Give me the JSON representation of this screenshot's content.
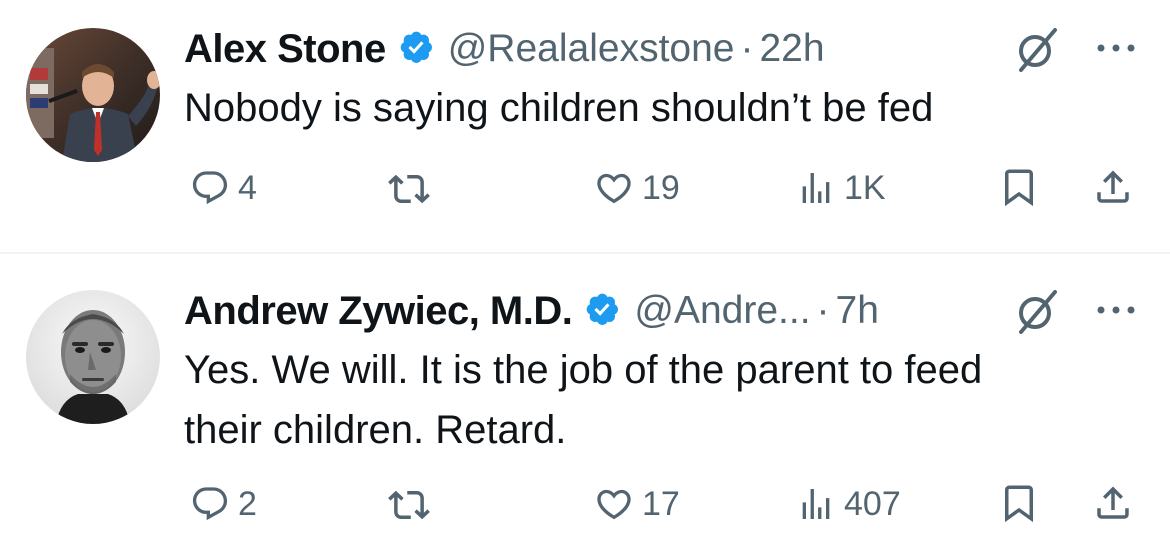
{
  "colors": {
    "verified": "#1d9bf0",
    "secondary_text": "#536471",
    "primary_text": "#0f1419",
    "divider": "#eff3f4"
  },
  "tweets": [
    {
      "author_name": "Alex Stone",
      "handle": "@Realalexstone",
      "separator": "·",
      "time": "22h",
      "text_lines": [
        "Nobody is saying children shouldn’t be fed"
      ],
      "replies": "4",
      "reposts": "",
      "likes": "19",
      "views": "1K",
      "icons": [
        "verified-badge-icon",
        "grok-icon",
        "more-icon",
        "reply-icon",
        "repost-icon",
        "like-icon",
        "views-icon",
        "bookmark-icon",
        "share-icon"
      ]
    },
    {
      "author_name": "Andrew Zywiec, M.D.",
      "handle": "@Andre...",
      "separator": "·",
      "time": "7h",
      "text_lines": [
        "Yes. We will. It is the job of the parent to feed",
        "their children. Retard."
      ],
      "replies": "2",
      "reposts": "",
      "likes": "17",
      "views": "407",
      "icons": [
        "verified-badge-icon",
        "grok-icon",
        "more-icon",
        "reply-icon",
        "repost-icon",
        "like-icon",
        "views-icon",
        "bookmark-icon",
        "share-icon"
      ]
    }
  ]
}
